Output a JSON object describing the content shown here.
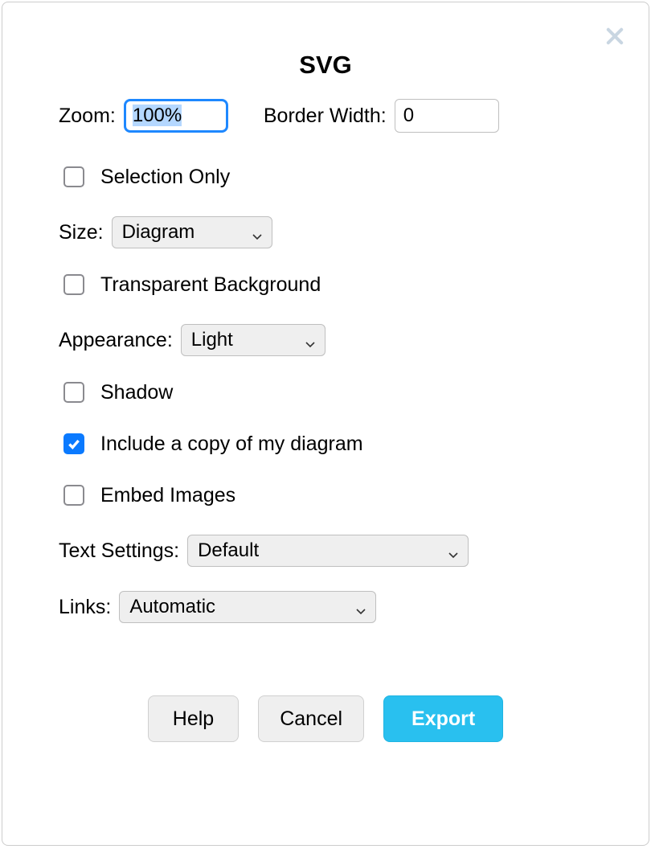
{
  "dialog": {
    "title": "SVG",
    "zoom_label": "Zoom:",
    "zoom_value": "100%",
    "border_width_label": "Border Width:",
    "border_width_value": "0",
    "selection_only_label": "Selection Only",
    "selection_only_checked": false,
    "size_label": "Size:",
    "size_value": "Diagram",
    "transparent_bg_label": "Transparent Background",
    "transparent_bg_checked": false,
    "appearance_label": "Appearance:",
    "appearance_value": "Light",
    "shadow_label": "Shadow",
    "shadow_checked": false,
    "include_copy_label": "Include a copy of my diagram",
    "include_copy_checked": true,
    "embed_images_label": "Embed Images",
    "embed_images_checked": false,
    "text_settings_label": "Text Settings:",
    "text_settings_value": "Default",
    "links_label": "Links:",
    "links_value": "Automatic",
    "buttons": {
      "help": "Help",
      "cancel": "Cancel",
      "export": "Export"
    }
  }
}
